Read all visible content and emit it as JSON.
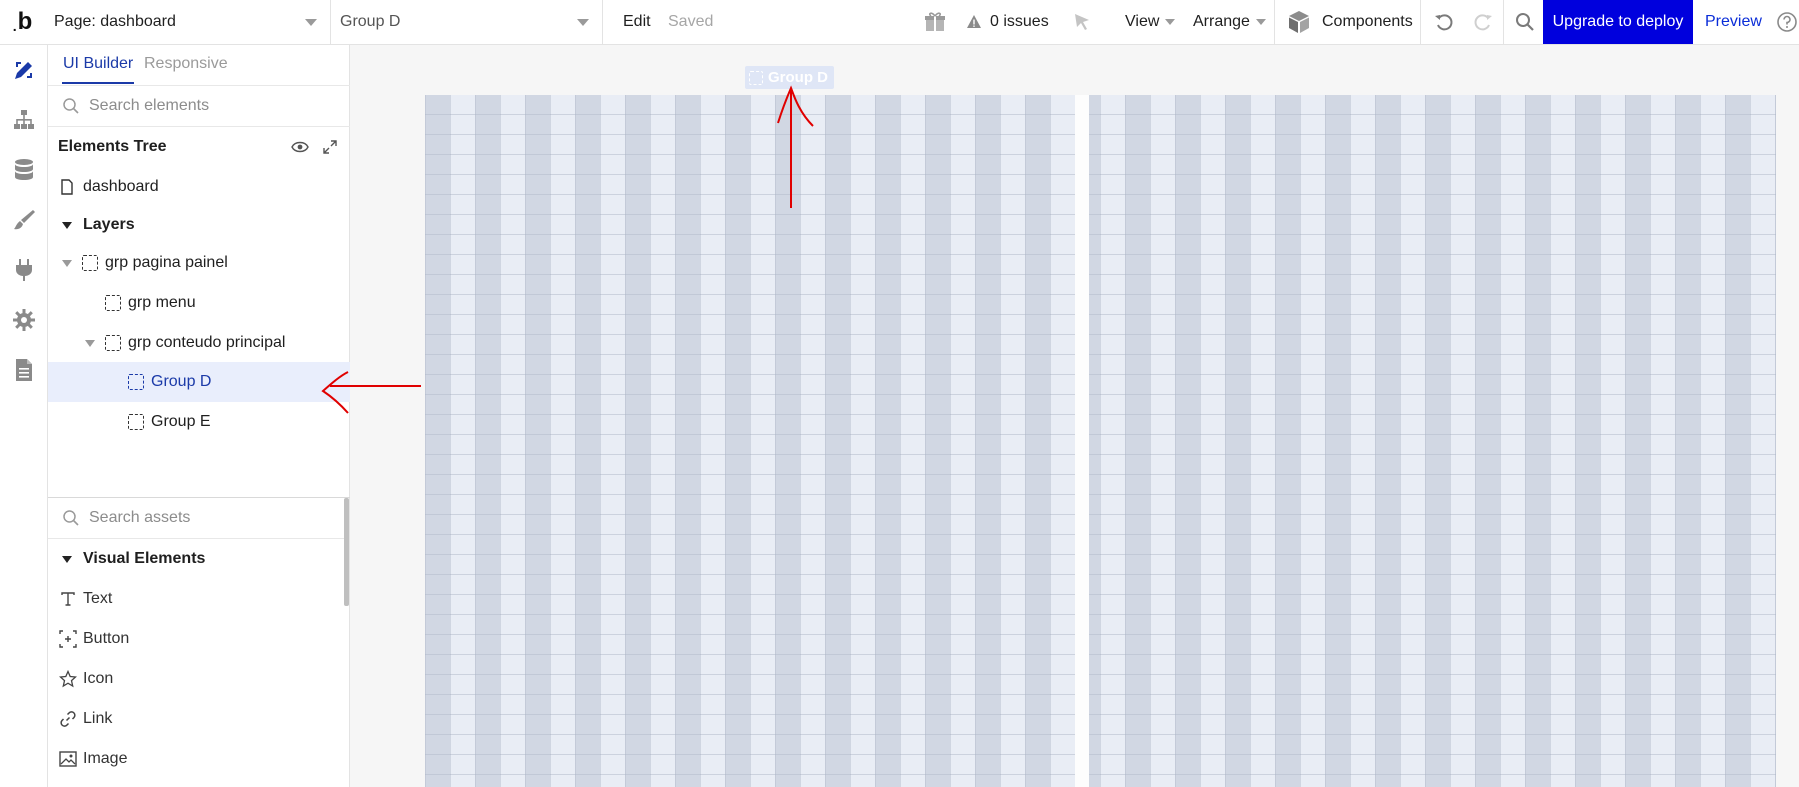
{
  "topbar": {
    "logo": "b",
    "page_select": "Page: dashboard",
    "element_select": "Group D",
    "edit": "Edit",
    "saved": "Saved",
    "issues": "0 issues",
    "view": "View",
    "arrange": "Arrange",
    "components": "Components",
    "upgrade": "Upgrade to deploy",
    "preview": "Preview"
  },
  "rail": [
    "design-icon",
    "workflow-icon",
    "data-icon",
    "styles-icon",
    "plugins-icon",
    "settings-icon",
    "logs-icon"
  ],
  "panel": {
    "tabs": {
      "ui_builder": "UI Builder",
      "responsive": "Responsive"
    },
    "search_placeholder": "Search elements",
    "tree_title": "Elements Tree",
    "tree": [
      {
        "label": "dashboard"
      },
      {
        "label": "Layers"
      },
      {
        "label": "grp pagina painel"
      },
      {
        "label": "grp menu"
      },
      {
        "label": "grp conteudo principal"
      },
      {
        "label": "Group D",
        "selected": true
      },
      {
        "label": "Group E"
      }
    ],
    "assets_search_placeholder": "Search assets",
    "visual_elements": "Visual Elements",
    "assets": [
      {
        "label": "Text",
        "icon": "text-icon"
      },
      {
        "label": "Button",
        "icon": "button-icon"
      },
      {
        "label": "Icon",
        "icon": "star-icon"
      },
      {
        "label": "Link",
        "icon": "link-icon"
      },
      {
        "label": "Image",
        "icon": "image-icon"
      }
    ]
  },
  "canvas": {
    "selected_tag": "Group D"
  },
  "colors": {
    "accent": "#1b3aa8",
    "upgrade_bg": "#0000dd",
    "annotation": "#e00000"
  }
}
